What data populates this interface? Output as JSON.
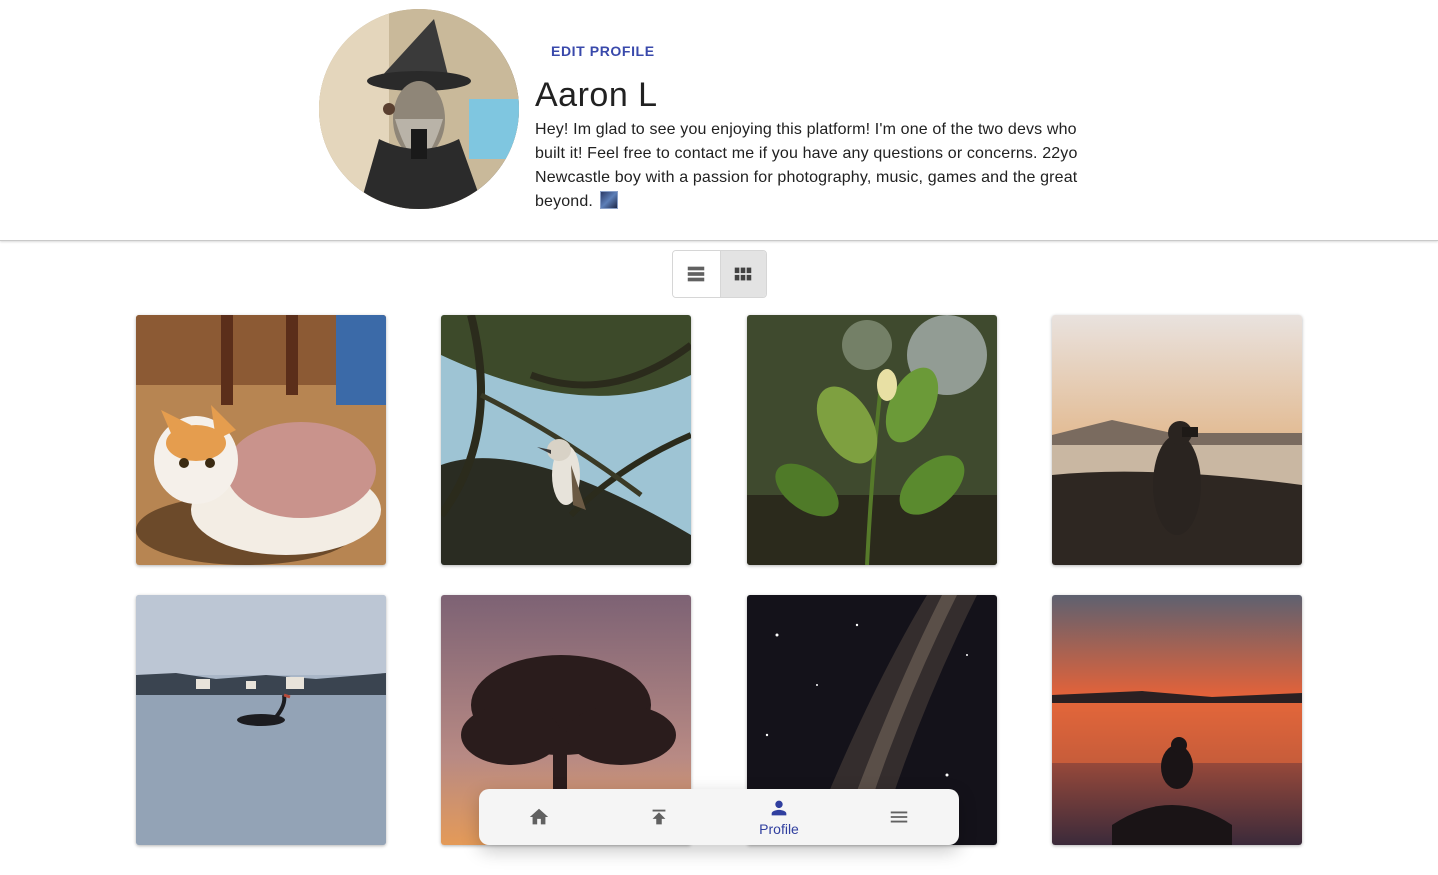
{
  "profile": {
    "edit_label": "EDIT PROFILE",
    "name": "Aaron L",
    "bio": "Hey! Im glad to see you enjoying this platform! I'm one of the two devs who built it! Feel free to contact me if you have any questions or concerns. 22yo Newcastle boy with a passion for photography, music, games and the great beyond.",
    "avatar_alt": "avatar"
  },
  "view_toggle": {
    "options": [
      "list-view",
      "grid-view"
    ],
    "selected": "grid-view"
  },
  "photos": [
    {
      "subject": "cat in pink sweater"
    },
    {
      "subject": "kookaburra in tree"
    },
    {
      "subject": "green leaves"
    },
    {
      "subject": "photographer silhouette at sunset"
    },
    {
      "subject": "black swan on water"
    },
    {
      "subject": "tree silhouette at dusk"
    },
    {
      "subject": "milky way night sky"
    },
    {
      "subject": "person silhouette at orange sunset"
    }
  ],
  "bottom_nav": {
    "items": [
      {
        "icon": "home-icon",
        "label": ""
      },
      {
        "icon": "upload-icon",
        "label": ""
      },
      {
        "icon": "person-icon",
        "label": "Profile"
      },
      {
        "icon": "menu-icon",
        "label": ""
      }
    ],
    "active": "Profile"
  },
  "colors": {
    "accent": "#3949ab",
    "active_nav": "#303f9f",
    "nav_bg": "#f5f5f5"
  }
}
